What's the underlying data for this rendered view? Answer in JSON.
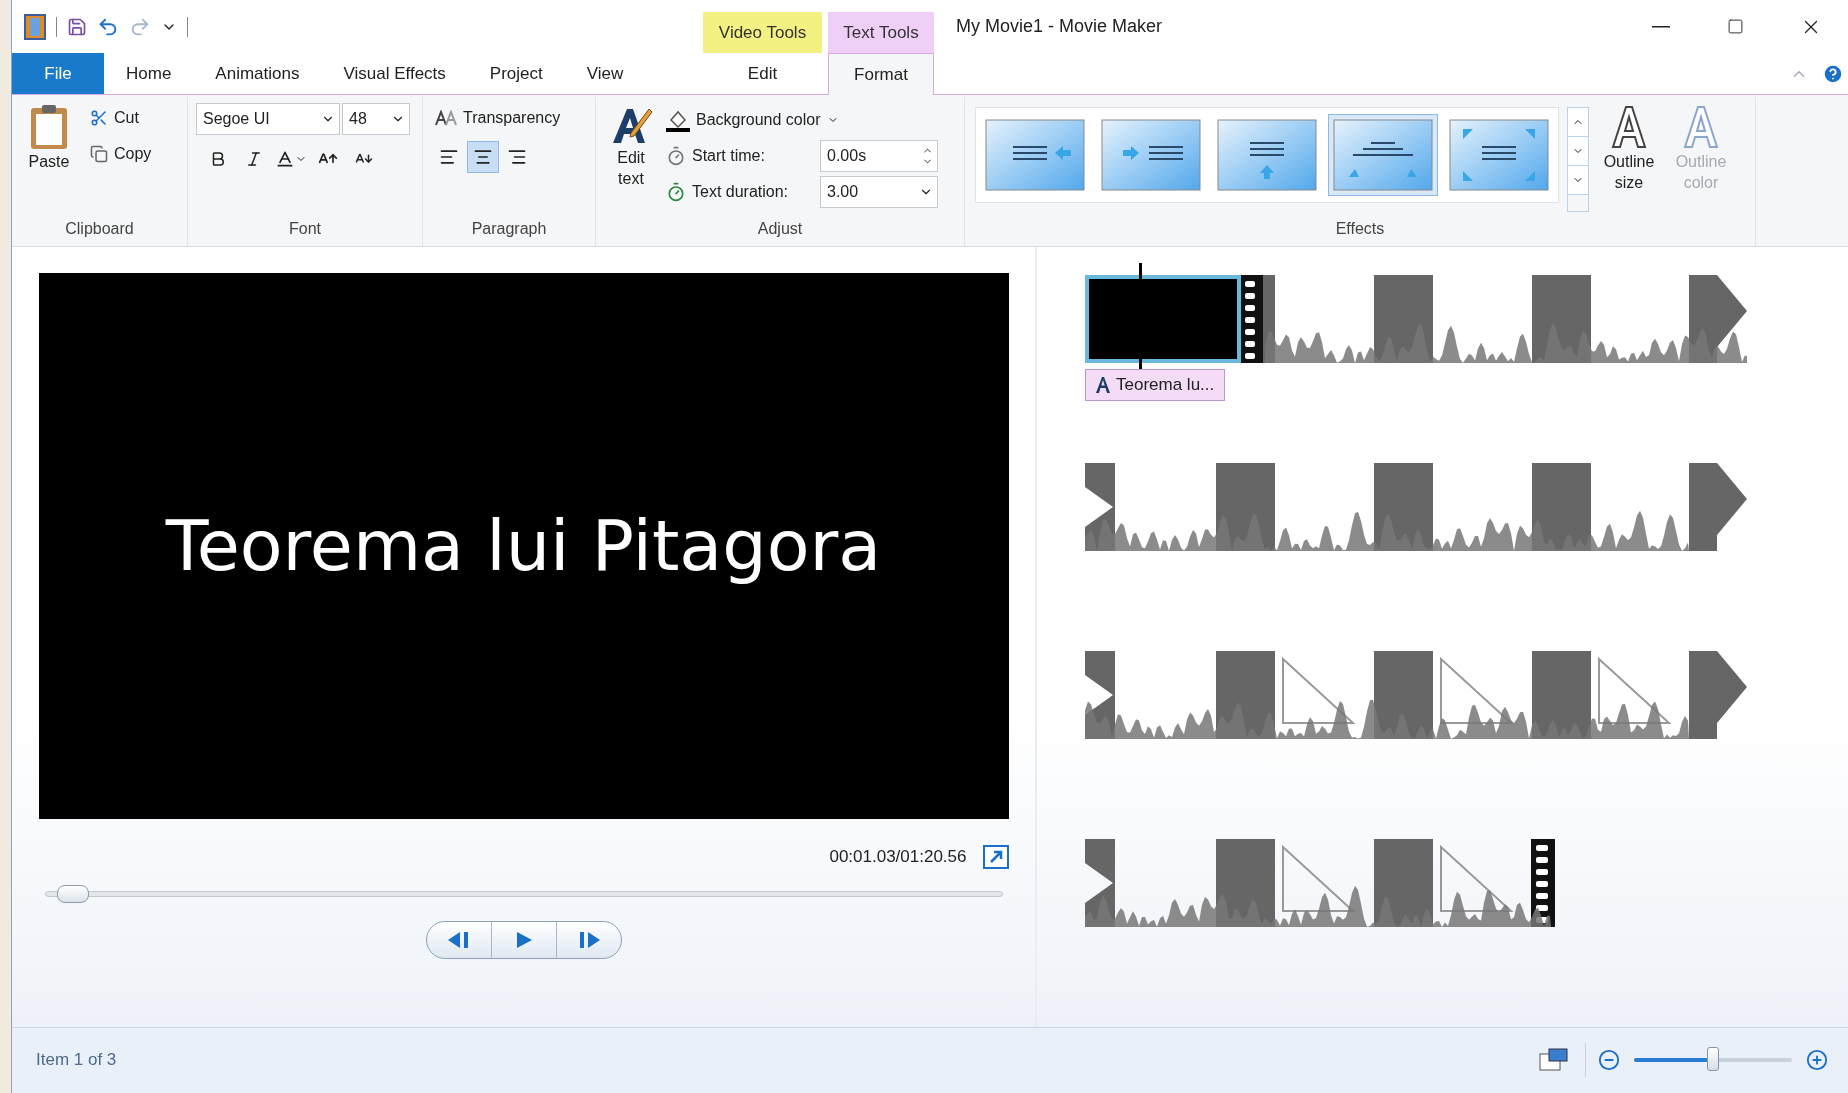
{
  "window": {
    "title": "My Movie1 - Movie Maker"
  },
  "tabs": [
    {
      "label": "File",
      "kind": "file",
      "selected": false
    },
    {
      "label": "Home",
      "kind": "tab",
      "selected": false
    },
    {
      "label": "Animations",
      "kind": "tab",
      "selected": false
    },
    {
      "label": "Visual Effects",
      "kind": "tab",
      "selected": false
    },
    {
      "label": "Project",
      "kind": "tab",
      "selected": false
    },
    {
      "label": "View",
      "kind": "tab",
      "selected": false
    }
  ],
  "context_groups": [
    {
      "label": "Video Tools",
      "color": "#f4f183",
      "tabs": [
        {
          "label": "Edit",
          "selected": false
        }
      ]
    },
    {
      "label": "Text Tools",
      "color": "#efcff5",
      "tabs": [
        {
          "label": "Format",
          "selected": true
        }
      ]
    }
  ],
  "clipboard": {
    "label": "Clipboard",
    "paste": "Paste",
    "cut": "Cut",
    "copy": "Copy"
  },
  "font": {
    "label": "Font",
    "family": "Segoe UI",
    "size": "48"
  },
  "paragraph": {
    "label": "Paragraph",
    "transparency": "Transparency",
    "alignments": [
      {
        "kind": "left",
        "selected": false
      },
      {
        "kind": "center",
        "selected": true
      },
      {
        "kind": "right",
        "selected": false
      }
    ]
  },
  "adjust": {
    "label": "Adjust",
    "edit_text": "Edit text",
    "background_color": "Background color",
    "start_time_label": "Start time:",
    "start_time": "0.00s",
    "duration_label": "Text duration:",
    "duration": "3.00"
  },
  "effects": {
    "label": "Effects",
    "options": [
      {
        "kind": "slide_left",
        "selected": false
      },
      {
        "kind": "slide_right",
        "selected": false
      },
      {
        "kind": "scroll_up",
        "selected": false
      },
      {
        "kind": "curve",
        "selected": true
      },
      {
        "kind": "zoom",
        "selected": false
      }
    ],
    "outline_size": {
      "label": "Outline size",
      "disabled": false
    },
    "outline_color": {
      "label": "Outline color",
      "disabled": true
    }
  },
  "preview": {
    "title": "Teorema lui Pitagora",
    "time": "00:01.03/01:20.56",
    "seek": {
      "level": 0.02
    }
  },
  "storyboard": {
    "rows": [
      {
        "kind": "start",
        "caption": "Teorema lu..."
      },
      {
        "kind": "middle"
      },
      {
        "kind": "triangles"
      },
      {
        "kind": "end"
      }
    ]
  },
  "status_bar": {
    "text": "Item 1 of 3",
    "zoom": {
      "level": 0.5
    }
  }
}
